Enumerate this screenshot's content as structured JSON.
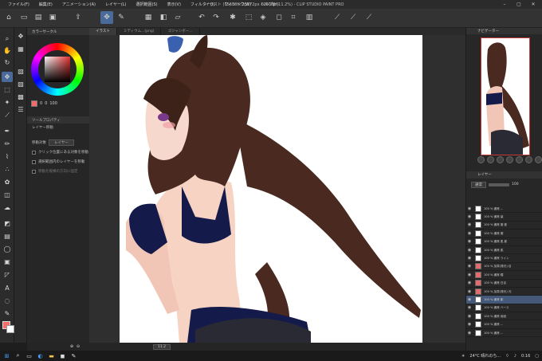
{
  "window": {
    "title": "イラスト (15680 x 23872px 1200dpi 11.2%) - CLIP STUDIO PAINT PRO",
    "menu": [
      "ファイル(F)",
      "編集(E)",
      "アニメーション(A)",
      "レイヤー(L)",
      "選択範囲(S)",
      "表示(V)",
      "フィルター(I)",
      "ウィンドウ(W)",
      "ヘルプ(H)"
    ]
  },
  "tabs": [
    "イラスト",
    "ミディウム...(png)",
    "ゴジャンボー..."
  ],
  "panels": {
    "color_wheel_title": "カラーサークル",
    "color_values": [
      "0",
      "0",
      "100"
    ],
    "tool_property_title": "ツールプロパティ",
    "tool_name": "レイヤー移動",
    "move_target_label": "移動対象",
    "move_target_value": "レイヤー",
    "options": [
      "クリック位置にある対象を移動",
      "選択範囲内のレイヤーを移動",
      "移動を縦横の方向に固定"
    ]
  },
  "navigator": {
    "title": "ナビゲーター"
  },
  "layer_panel": {
    "title": "レイヤー",
    "blend_mode": "通常",
    "opacity": "100",
    "layers": [
      {
        "name": "100 % 通常 ..."
      },
      {
        "name": "100 % 通常 髪"
      },
      {
        "name": "100 % 通常 服 影"
      },
      {
        "name": "100 % 通常 服"
      },
      {
        "name": "100 % 通常 肌 影"
      },
      {
        "name": "100 % 通常 肌"
      },
      {
        "name": "100 % 通常 ライン"
      },
      {
        "name": "100 % 加算(発光) 目"
      },
      {
        "name": "100 % 通常 瞳"
      },
      {
        "name": "100 % 通常 白目"
      },
      {
        "name": "100 % 加算(発光) 光"
      },
      {
        "name": "100 % 通常 影",
        "selected": true
      },
      {
        "name": "100 % 通常 ベース"
      },
      {
        "name": "100 % 通常 用紙"
      },
      {
        "name": "100 % 通常 ..."
      },
      {
        "name": "100 % 通常 ..."
      }
    ]
  },
  "status": {
    "zoom": "11.2"
  },
  "taskbar": {
    "weather": "24°C 晴れのち...",
    "time": "0:16"
  },
  "colors": {
    "accent": "#4a6a9a",
    "foreground": "#f36b6b",
    "outfit": "#141a4a",
    "hair": "#4a2a20"
  }
}
